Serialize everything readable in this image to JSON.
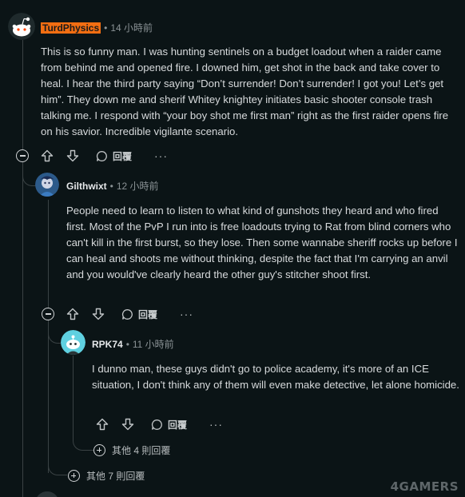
{
  "comments": [
    {
      "username": "TurdPhysics",
      "time": "14 小時前",
      "body": "This is so funny man. I was hunting sentinels on a budget loadout when a raider came from behind me and opened fire. I downed him, get shot in the back and take cover to heal. I hear the third party saying “Don’t surrender! Don’t surrender! I got you! Let’s get him”. They down me and sherif Whitey knightey initiates basic shooter console trash talking me. I respond with “your boy shot me first man” right as the first raider opens fire on his savior. Incredible vigilante scenario.",
      "reply_label": "回覆"
    },
    {
      "username": "Gilthwixt",
      "time": "12 小時前",
      "body": "People need to learn to listen to what kind of gunshots they heard and who fired first. Most of the PvP I run into is free loadouts trying to Rat from blind corners who can't kill in the first burst, so they lose. Then some wannabe sheriff rocks up before I can heal and shoots me without thinking, despite the fact that I'm carrying an anvil and you would've clearly heard the other guy's stitcher shoot first.",
      "reply_label": "回覆"
    },
    {
      "username": "RPK74",
      "time": "11 小時前",
      "body": "I dunno man, these guys didn't go to police academy, it's more of an ICE situation, I don't think any of them will even make detective, let alone homicide.",
      "reply_label": "回覆"
    }
  ],
  "more_replies_nested": "其他 4 則回覆",
  "more_replies_top": "其他 7 則回覆",
  "dot": "•",
  "more_symbol": "···",
  "watermark": "4GAMERS",
  "colors": {
    "background": "#0b1416",
    "op_highlight": "#f26e12",
    "thread_line": "#3a4244"
  }
}
